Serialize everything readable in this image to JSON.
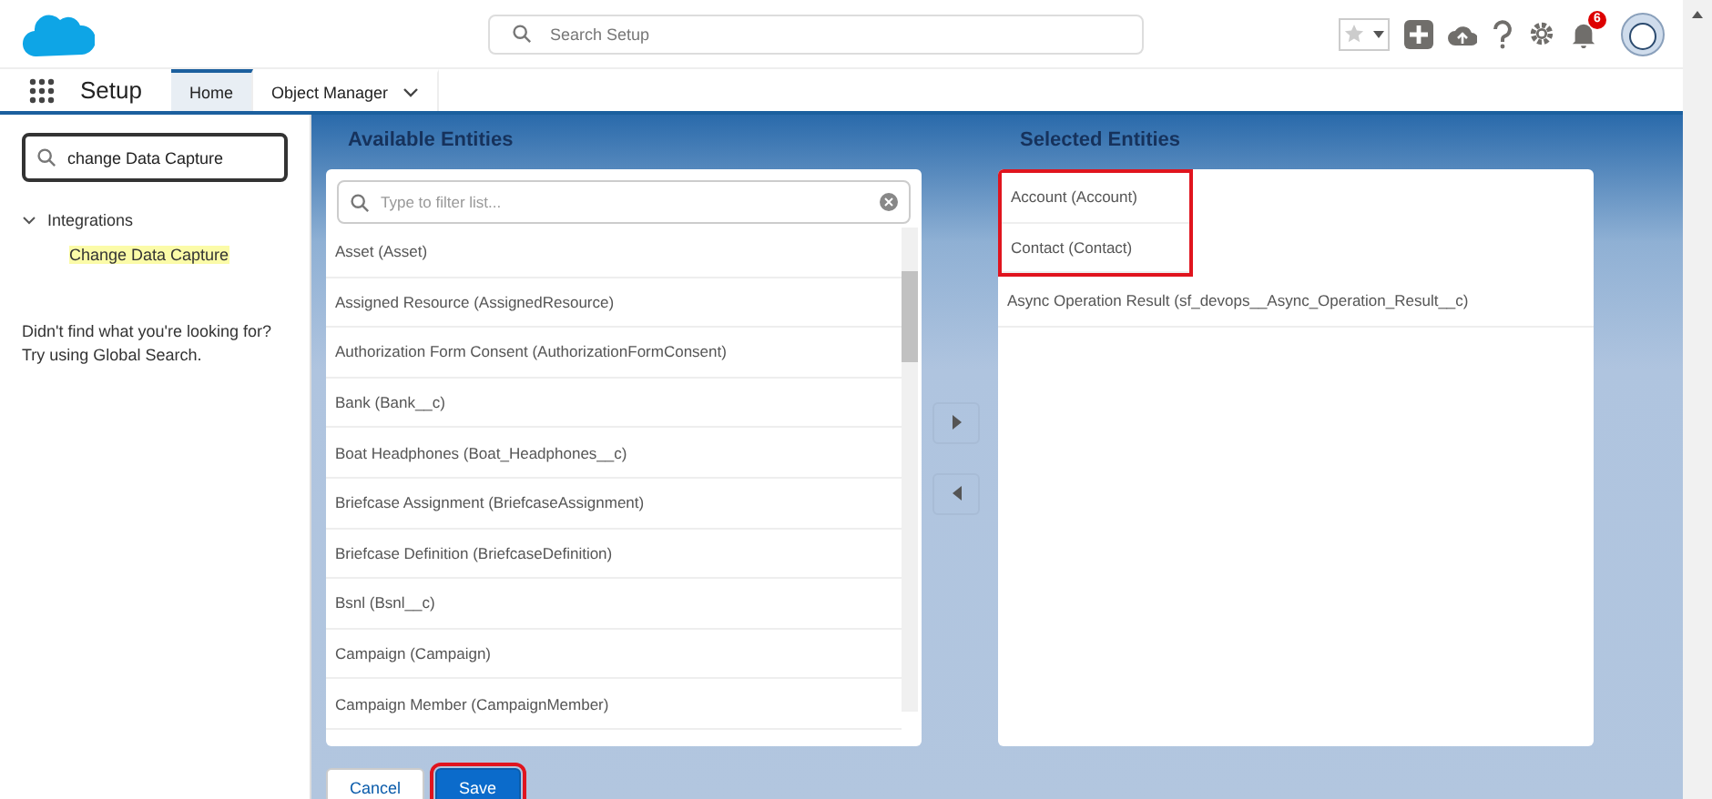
{
  "header": {
    "search_placeholder": "Search Setup",
    "notification_count": "6"
  },
  "nav": {
    "app_name": "Setup",
    "tabs": [
      {
        "label": "Home",
        "selected": true,
        "has_menu": false
      },
      {
        "label": "Object Manager",
        "selected": false,
        "has_menu": true
      }
    ]
  },
  "sidebar": {
    "search_value": "change Data Capture",
    "tree": [
      {
        "label": "Integrations",
        "expanded": true,
        "children": [
          {
            "label": "Change Data Capture",
            "matched": true
          }
        ]
      }
    ],
    "hint": [
      "Didn't find what you're looking for?",
      "Try using Global Search."
    ]
  },
  "available": {
    "title": "Available Entities",
    "filter_placeholder": "Type to filter list...",
    "items": [
      {
        "label": "Asset (Asset)"
      },
      {
        "label": "Assigned Resource (AssignedResource)"
      },
      {
        "label": "Authorization Form Consent (AuthorizationFormConsent)"
      },
      {
        "label": "Bank (Bank__c)"
      },
      {
        "label": "Boat Headphones (Boat_Headphones__c)"
      },
      {
        "label": "Briefcase Assignment (BriefcaseAssignment)"
      },
      {
        "label": "Briefcase Definition (BriefcaseDefinition)"
      },
      {
        "label": "Bsnl (Bsnl__c)"
      },
      {
        "label": "Campaign (Campaign)"
      },
      {
        "label": "Campaign Member (CampaignMember)"
      }
    ]
  },
  "selected": {
    "title": "Selected Entities",
    "items": [
      {
        "label": "Account (Account)",
        "highlighted": true
      },
      {
        "label": "Contact (Contact)",
        "highlighted": true
      },
      {
        "label": "Async Operation Result (sf_devops__Async_Operation_Result__c)",
        "highlighted": false
      }
    ]
  },
  "buttons": [
    {
      "label": "Cancel",
      "kind": "neutral",
      "highlighted": false
    },
    {
      "label": "Save",
      "kind": "brand",
      "highlighted": true
    }
  ]
}
